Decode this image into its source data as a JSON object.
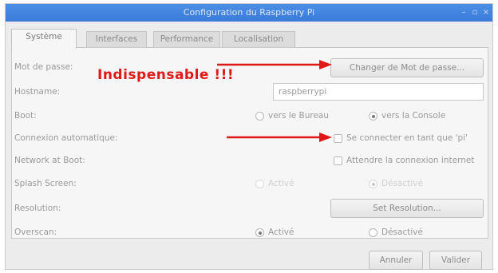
{
  "window": {
    "title": "Configuration du Raspberry Pi",
    "controls": {
      "minimize": "–",
      "maximize": "▫",
      "close": "×"
    }
  },
  "tabs": [
    {
      "label": "Système",
      "active": true
    },
    {
      "label": "Interfaces",
      "active": false
    },
    {
      "label": "Performance",
      "active": false
    },
    {
      "label": "Localisation",
      "active": false
    }
  ],
  "rows": {
    "password": {
      "label": "Mot de passe:",
      "button": "Changer de Mot de passe..."
    },
    "hostname": {
      "label": "Hostname:",
      "value": "raspberrypi"
    },
    "boot": {
      "label": "Boot:",
      "opt1": "vers le Bureau",
      "opt2": "vers la Console",
      "selected": "opt2"
    },
    "autologin": {
      "label": "Connexion automatique:",
      "checkbox": "Se connecter en tant que 'pi'",
      "checked": false
    },
    "network_boot": {
      "label": "Network at Boot:",
      "checkbox": "Attendre la connexion internet",
      "checked": false
    },
    "splash": {
      "label": "Splash Screen:",
      "opt1": "Activé",
      "opt2": "Désactivé",
      "selected": "opt2",
      "disabled": true
    },
    "resolution": {
      "label": "Resolution:",
      "button": "Set Resolution..."
    },
    "overscan": {
      "label": "Overscan:",
      "opt1": "Activé",
      "opt2": "Désactivé",
      "selected": "opt1"
    }
  },
  "footer": {
    "cancel": "Annuler",
    "ok": "Valider"
  },
  "annotation": {
    "text": "Indispensable !!!",
    "color": "#e01818"
  }
}
